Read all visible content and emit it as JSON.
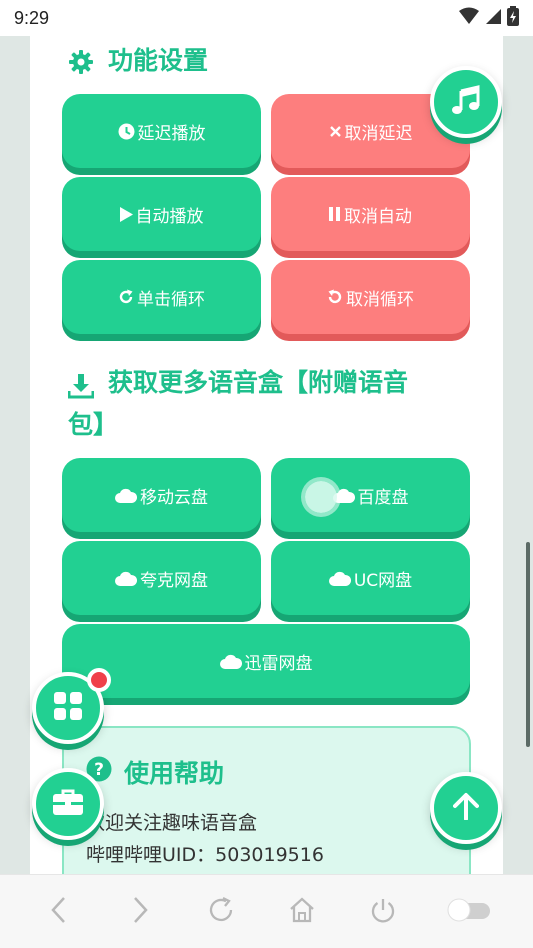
{
  "status_bar": {
    "time": "9:29"
  },
  "settings": {
    "title": "功能设置",
    "buttons": [
      {
        "label": "延迟播放",
        "icon": "clock-icon",
        "color": "#22d092"
      },
      {
        "label": "取消延迟",
        "icon": "close-icon",
        "color": "#fd7e7e"
      },
      {
        "label": "自动播放",
        "icon": "play-icon",
        "color": "#22d092"
      },
      {
        "label": "取消自动",
        "icon": "pause-icon",
        "color": "#fd7e7e"
      },
      {
        "label": "单击循环",
        "icon": "redo-icon",
        "color": "#22d092"
      },
      {
        "label": "取消循环",
        "icon": "undo-icon",
        "color": "#fd7e7e"
      }
    ]
  },
  "download": {
    "title_line1": "获取更多语音盒【附赠语音",
    "title_line2": "包】",
    "buttons": [
      {
        "label": "移动云盘",
        "icon": "cloud-icon"
      },
      {
        "label": "百度盘",
        "icon": "cloud-icon"
      },
      {
        "label": "夸克网盘",
        "icon": "cloud-icon"
      },
      {
        "label": "UC网盘",
        "icon": "cloud-icon"
      },
      {
        "label": "迅雷网盘",
        "icon": "cloud-icon"
      }
    ]
  },
  "help": {
    "title": "使用帮助",
    "line1": "欢迎关注趣味语音盒",
    "line2": "哔哩哔哩UID：503019516"
  },
  "colors": {
    "accent": "#22d092",
    "accent_dark": "#16a674",
    "danger": "#fd7e7e",
    "notification": "#f0404a"
  }
}
